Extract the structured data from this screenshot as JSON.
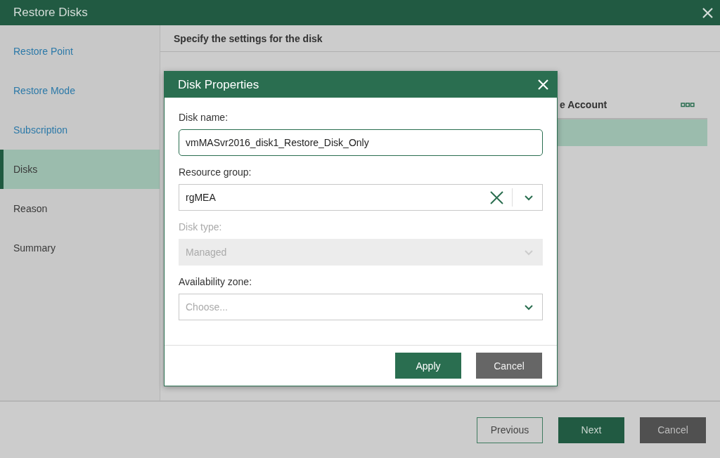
{
  "window": {
    "title": "Restore Disks"
  },
  "steps": [
    {
      "label": "Restore Point",
      "selected": false,
      "visited": true
    },
    {
      "label": "Restore Mode",
      "selected": false,
      "visited": true
    },
    {
      "label": "Subscription",
      "selected": false,
      "visited": true
    },
    {
      "label": "Disks",
      "selected": true,
      "visited": false
    },
    {
      "label": "Reason",
      "selected": false,
      "visited": false
    },
    {
      "label": "Summary",
      "selected": false,
      "visited": false
    }
  ],
  "content": {
    "heading": "Specify the settings for the disk",
    "table": {
      "column_header": "e Account",
      "rows": [
        {
          "selected": true
        }
      ]
    }
  },
  "dialog": {
    "title": "Disk Properties",
    "fields": [
      {
        "kind": "text",
        "label": "Disk name:",
        "value": "vmMASvr2016_disk1_Restore_Disk_Only",
        "focused": true,
        "disabled": false,
        "clearable": false
      },
      {
        "kind": "select",
        "label": "Resource group:",
        "value": "rgMEA",
        "focused": false,
        "disabled": false,
        "clearable": true
      },
      {
        "kind": "select",
        "label": "Disk type:",
        "value": "Managed",
        "focused": false,
        "disabled": true,
        "clearable": false
      },
      {
        "kind": "select",
        "label": "Availability zone:",
        "placeholder": "Choose...",
        "focused": false,
        "disabled": false,
        "clearable": false
      }
    ],
    "buttons": [
      {
        "label": "Apply",
        "kind": "primary"
      },
      {
        "label": "Cancel",
        "kind": "secondary"
      }
    ]
  },
  "footer": {
    "buttons": [
      {
        "label": "Previous",
        "kind": "outline"
      },
      {
        "label": "Next",
        "kind": "primary"
      },
      {
        "label": "Cancel",
        "kind": "secondary"
      }
    ]
  }
}
